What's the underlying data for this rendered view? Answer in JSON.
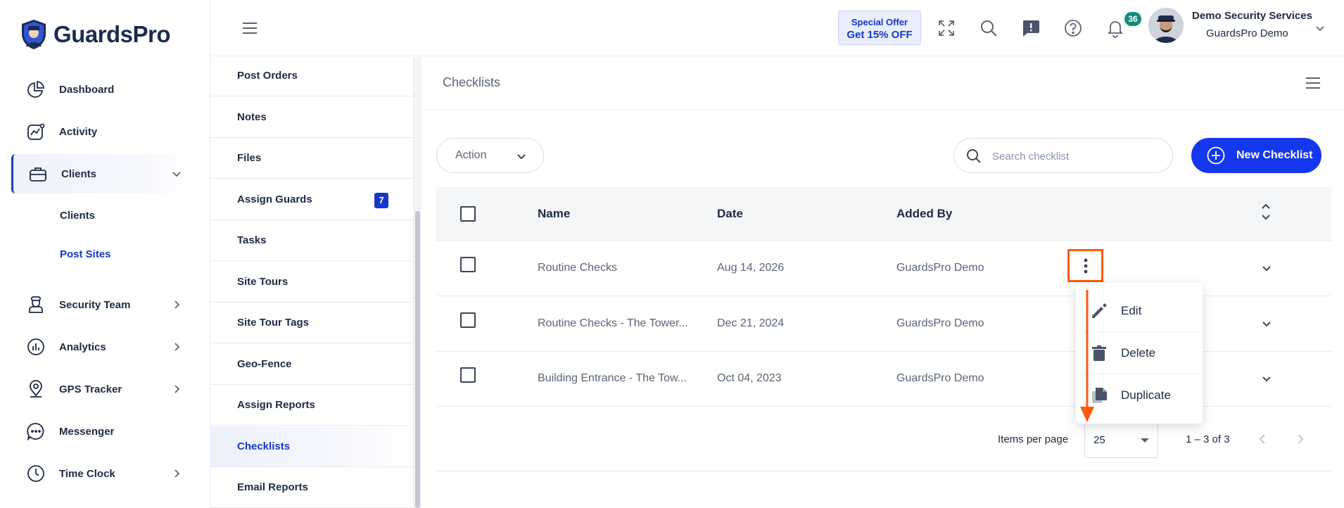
{
  "brand": {
    "name": "GuardsPro"
  },
  "nav": {
    "items": [
      {
        "label": "Dashboard",
        "icon": "pie-chart-icon"
      },
      {
        "label": "Activity",
        "icon": "activity-chart-icon"
      },
      {
        "label": "Clients",
        "icon": "briefcase-icon"
      },
      {
        "label": "Security Team",
        "icon": "guard-icon"
      },
      {
        "label": "Analytics",
        "icon": "analytics-icon"
      },
      {
        "label": "GPS Tracker",
        "icon": "map-pin-icon"
      },
      {
        "label": "Messenger",
        "icon": "chat-icon"
      },
      {
        "label": "Time Clock",
        "icon": "clock-icon"
      }
    ],
    "clients_sub": [
      "Clients",
      "Post Sites"
    ]
  },
  "topbar": {
    "offer_line1": "Special Offer",
    "offer_line2": "Get 15% OFF",
    "notification_count": "36",
    "user_name": "Demo Security Services",
    "user_org": "GuardsPro Demo"
  },
  "subnav": {
    "items": [
      "Post Orders",
      "Notes",
      "Files",
      "Assign Guards",
      "Tasks",
      "Site Tours",
      "Site Tour Tags",
      "Geo-Fence",
      "Assign Reports",
      "Checklists",
      "Email Reports"
    ],
    "assign_guards_count": "7",
    "active": "Checklists"
  },
  "main": {
    "title": "Checklists",
    "action_label": "Action",
    "search_placeholder": "Search checklist",
    "new_button": "New Checklist",
    "columns": {
      "name": "Name",
      "date": "Date",
      "added_by": "Added By"
    },
    "rows": [
      {
        "name": "Routine Checks",
        "date": "Aug 14, 2026",
        "added_by": "GuardsPro Demo"
      },
      {
        "name": "Routine Checks - The Tower...",
        "date": "Dec 21, 2024",
        "added_by": "GuardsPro Demo"
      },
      {
        "name": "Building Entrance - The Tow...",
        "date": "Oct 04, 2023",
        "added_by": "GuardsPro Demo"
      }
    ],
    "context_menu": [
      "Edit",
      "Delete",
      "Duplicate"
    ],
    "pager": {
      "items_per_page_label": "Items per page",
      "items_per_page": "25",
      "range": "1 – 3 of 3"
    }
  },
  "colors": {
    "accent": "#1537ee",
    "highlight": "#ff5a0a",
    "badge": "#0f8f7a"
  }
}
